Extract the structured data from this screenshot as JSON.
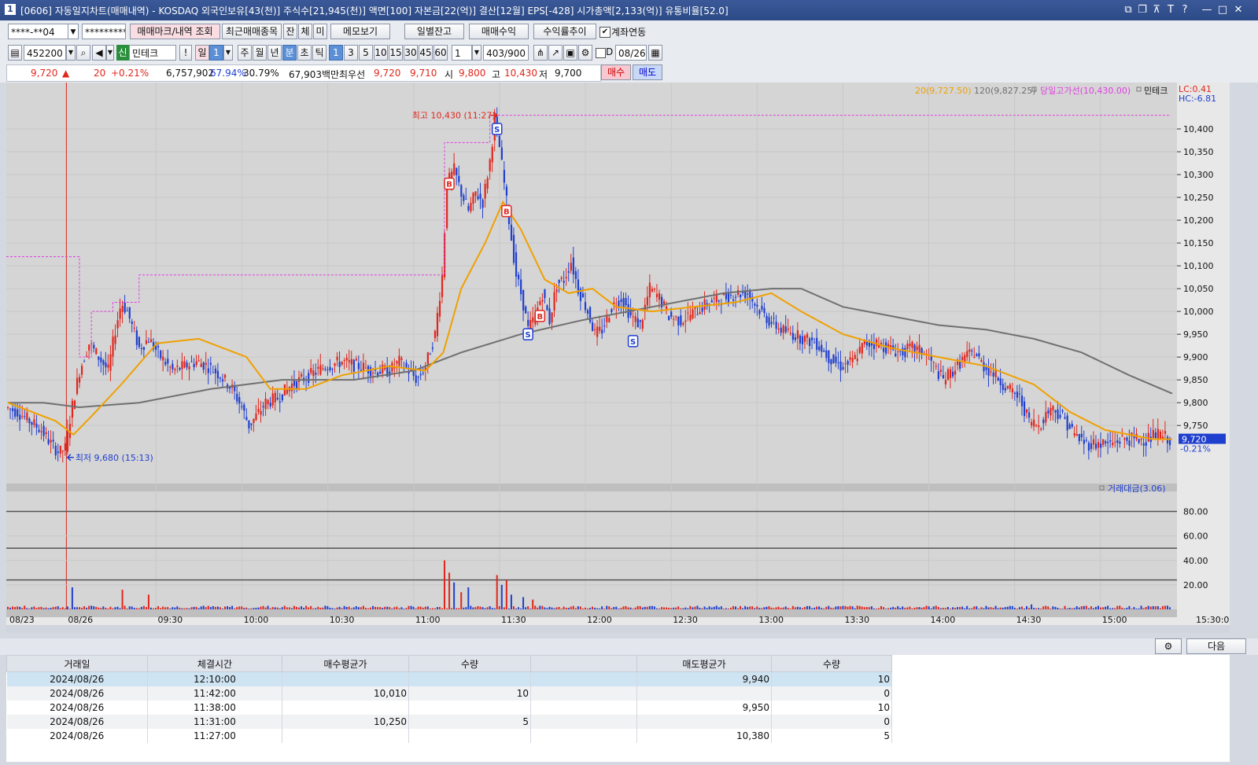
{
  "window": {
    "title": "[0606] 자동일지차트(매매내역) - KOSDAQ 외국인보유[43(천)] 주식수[21,945(천)] 액면[100] 자본금[22(억)] 결산[12월] EPS[-428] 시가총액[2,133(억)] 유통비율[52.0]",
    "app_num": "1"
  },
  "toolbar1": {
    "account": "****-**04",
    "password": "*********",
    "btn_markers": "매매마크/내역 조회",
    "btn_recent": "최근매매종목",
    "btn_jan": "잔",
    "btn_che": "체",
    "btn_mi": "미",
    "btn_memo": "메모보기",
    "btn_daily_bal": "일별잔고",
    "btn_profit": "매매수익",
    "btn_rate": "수익률추이",
    "chk_account_link": "계좌연동"
  },
  "toolbar2": {
    "code": "452200",
    "credit_badge": "신",
    "name": "민테크",
    "btn_excl": "!",
    "btn_day": "일",
    "day_val": "1",
    "periods": [
      "주",
      "월",
      "년",
      "분",
      "초",
      "틱"
    ],
    "intervals": [
      "1",
      "3",
      "5",
      "10",
      "15",
      "30",
      "45",
      "60"
    ],
    "count_val": "1",
    "range_text": "403/900",
    "d_label": "D",
    "date": "08/26"
  },
  "quote": {
    "price": "9,720",
    "arrow": "▲",
    "change": "20",
    "change_pct": "+0.21%",
    "volume": "6,757,902",
    "pct1": "67.94%",
    "pct2": "30.79%",
    "amount": "67,903백만",
    "best_label": "최우선",
    "ask": "9,720",
    "bid": "9,710",
    "open_label": "시",
    "open": "9,800",
    "high_label": "고",
    "high": "10,430",
    "low_label": "저",
    "low": "9,700",
    "btn_buy": "매수",
    "btn_sell": "매도"
  },
  "chart_data": {
    "type": "candlestick",
    "title": "",
    "legend": {
      "ma20": "20(9,727.50)",
      "ma120": "120(9,827.25)",
      "day_high_line": "당일고가선(10,430.00)",
      "stock": "민테크",
      "lc": "LC:0.41",
      "hc": "HC:-6.81"
    },
    "colors": {
      "up": "#e0261c",
      "down": "#1f3fcf",
      "ma20": "#f0a000",
      "ma120": "#707070",
      "day_high": "#e040e0",
      "grid": "#c8c8c8",
      "bg": "#d5d5d5"
    },
    "y_ticks": [
      "10,400",
      "10,350",
      "10,300",
      "10,250",
      "10,200",
      "10,150",
      "10,100",
      "10,050",
      "10,000",
      "9,950",
      "9,900",
      "9,850",
      "9,800",
      "9,750"
    ],
    "y_range": [
      9640,
      10450
    ],
    "current_price": "9,720",
    "current_pct": "-0.21%",
    "x_ticks": [
      "08/23",
      "08/26",
      "09:30",
      "10:00",
      "10:30",
      "11:00",
      "11:30",
      "12:00",
      "12:30",
      "13:00",
      "13:30",
      "14:00",
      "14:30",
      "15:00",
      "15:30:00"
    ],
    "annotations": {
      "high": "최고 10,430 (11:27)",
      "low": "최저 9,680 (15:13)"
    },
    "price_path": [
      [
        0,
        9790
      ],
      [
        10,
        9780
      ],
      [
        20,
        9760
      ],
      [
        30,
        9740
      ],
      [
        38,
        9710
      ],
      [
        45,
        9690
      ],
      [
        50,
        9700
      ],
      [
        55,
        9780
      ],
      [
        62,
        9870
      ],
      [
        70,
        9930
      ],
      [
        78,
        9900
      ],
      [
        86,
        9870
      ],
      [
        92,
        9960
      ],
      [
        97,
        10020
      ],
      [
        102,
        10000
      ],
      [
        107,
        9960
      ],
      [
        112,
        9920
      ],
      [
        120,
        9940
      ],
      [
        130,
        9900
      ],
      [
        140,
        9870
      ],
      [
        150,
        9880
      ],
      [
        160,
        9890
      ],
      [
        170,
        9880
      ],
      [
        180,
        9860
      ],
      [
        190,
        9830
      ],
      [
        198,
        9790
      ],
      [
        204,
        9750
      ],
      [
        210,
        9770
      ],
      [
        218,
        9800
      ],
      [
        228,
        9810
      ],
      [
        240,
        9840
      ],
      [
        255,
        9860
      ],
      [
        268,
        9880
      ],
      [
        282,
        9890
      ],
      [
        296,
        9880
      ],
      [
        310,
        9870
      ],
      [
        322,
        9870
      ],
      [
        330,
        9890
      ],
      [
        338,
        9870
      ],
      [
        345,
        9850
      ],
      [
        352,
        9880
      ],
      [
        360,
        9950
      ],
      [
        366,
        10080
      ],
      [
        370,
        10280
      ],
      [
        376,
        10310
      ],
      [
        382,
        10260
      ],
      [
        388,
        10220
      ],
      [
        394,
        10260
      ],
      [
        400,
        10240
      ],
      [
        406,
        10330
      ],
      [
        410,
        10420
      ],
      [
        414,
        10360
      ],
      [
        418,
        10280
      ],
      [
        423,
        10180
      ],
      [
        428,
        10080
      ],
      [
        433,
        10030
      ],
      [
        438,
        9960
      ],
      [
        444,
        9990
      ],
      [
        450,
        10040
      ],
      [
        456,
        9980
      ],
      [
        462,
        10060
      ],
      [
        468,
        10070
      ],
      [
        474,
        10110
      ],
      [
        480,
        10050
      ],
      [
        488,
        10000
      ],
      [
        494,
        9950
      ],
      [
        500,
        9960
      ],
      [
        508,
        10010
      ],
      [
        516,
        10030
      ],
      [
        524,
        9990
      ],
      [
        532,
        9970
      ],
      [
        540,
        10050
      ],
      [
        548,
        10030
      ],
      [
        556,
        9990
      ],
      [
        566,
        9980
      ],
      [
        578,
        10000
      ],
      [
        590,
        10020
      ],
      [
        602,
        10030
      ],
      [
        614,
        10040
      ],
      [
        622,
        10040
      ],
      [
        630,
        10010
      ],
      [
        640,
        9980
      ],
      [
        650,
        9960
      ],
      [
        660,
        9950
      ],
      [
        670,
        9940
      ],
      [
        680,
        9930
      ],
      [
        690,
        9900
      ],
      [
        700,
        9880
      ],
      [
        710,
        9890
      ],
      [
        720,
        9930
      ],
      [
        730,
        9930
      ],
      [
        740,
        9920
      ],
      [
        750,
        9910
      ],
      [
        760,
        9920
      ],
      [
        770,
        9910
      ],
      [
        778,
        9880
      ],
      [
        786,
        9850
      ],
      [
        794,
        9870
      ],
      [
        804,
        9900
      ],
      [
        812,
        9910
      ],
      [
        820,
        9880
      ],
      [
        830,
        9860
      ],
      [
        840,
        9830
      ],
      [
        850,
        9810
      ],
      [
        858,
        9760
      ],
      [
        866,
        9750
      ],
      [
        876,
        9790
      ],
      [
        886,
        9770
      ],
      [
        896,
        9730
      ],
      [
        906,
        9710
      ],
      [
        916,
        9710
      ],
      [
        926,
        9710
      ],
      [
        936,
        9720
      ],
      [
        946,
        9720
      ],
      [
        956,
        9720
      ],
      [
        966,
        9730
      ],
      [
        976,
        9720
      ]
    ],
    "ma20_path": [
      [
        0,
        9800
      ],
      [
        40,
        9760
      ],
      [
        55,
        9730
      ],
      [
        70,
        9770
      ],
      [
        95,
        9840
      ],
      [
        125,
        9930
      ],
      [
        160,
        9940
      ],
      [
        200,
        9900
      ],
      [
        220,
        9830
      ],
      [
        250,
        9830
      ],
      [
        280,
        9860
      ],
      [
        320,
        9880
      ],
      [
        350,
        9870
      ],
      [
        365,
        9910
      ],
      [
        380,
        10050
      ],
      [
        400,
        10150
      ],
      [
        415,
        10240
      ],
      [
        430,
        10180
      ],
      [
        450,
        10070
      ],
      [
        470,
        10040
      ],
      [
        490,
        10050
      ],
      [
        510,
        10010
      ],
      [
        540,
        10000
      ],
      [
        575,
        10010
      ],
      [
        610,
        10020
      ],
      [
        640,
        10040
      ],
      [
        665,
        10000
      ],
      [
        700,
        9950
      ],
      [
        740,
        9920
      ],
      [
        780,
        9900
      ],
      [
        820,
        9880
      ],
      [
        860,
        9840
      ],
      [
        890,
        9780
      ],
      [
        920,
        9740
      ],
      [
        960,
        9720
      ],
      [
        976,
        9720
      ]
    ],
    "ma120_path": [
      [
        0,
        9800
      ],
      [
        30,
        9800
      ],
      [
        60,
        9790
      ],
      [
        110,
        9800
      ],
      [
        170,
        9830
      ],
      [
        230,
        9850
      ],
      [
        290,
        9850
      ],
      [
        340,
        9870
      ],
      [
        380,
        9910
      ],
      [
        430,
        9950
      ],
      [
        480,
        9980
      ],
      [
        540,
        10010
      ],
      [
        600,
        10040
      ],
      [
        640,
        10050
      ],
      [
        665,
        10050
      ],
      [
        700,
        10010
      ],
      [
        740,
        9990
      ],
      [
        780,
        9970
      ],
      [
        820,
        9960
      ],
      [
        860,
        9940
      ],
      [
        900,
        9910
      ],
      [
        940,
        9860
      ],
      [
        976,
        9820
      ]
    ],
    "day_high_line": 10420,
    "trade_marks": [
      {
        "type": "B",
        "label": "B",
        "i": 370,
        "price": 10280
      },
      {
        "type": "S",
        "label": "S",
        "i": 410,
        "price": 10400
      },
      {
        "type": "B",
        "label": "B",
        "i": 418,
        "price": 10220
      },
      {
        "type": "S",
        "label": "S",
        "i": 436,
        "price": 9950
      },
      {
        "type": "B",
        "label": "B",
        "i": 446,
        "price": 9990
      },
      {
        "type": "S",
        "label": "S",
        "i": 524,
        "price": 9935
      }
    ],
    "volume_panel": {
      "legend": "거래대금(3.06)",
      "y_ticks": [
        "80.00",
        "60.00",
        "40.00",
        "20.00"
      ],
      "y_range": [
        0,
        90
      ],
      "spikes": [
        {
          "i": 55,
          "v": 18,
          "up": false
        },
        {
          "i": 96,
          "v": 16,
          "up": true
        },
        {
          "i": 118,
          "v": 12,
          "up": true
        },
        {
          "i": 366,
          "v": 40,
          "up": true
        },
        {
          "i": 370,
          "v": 30,
          "up": true
        },
        {
          "i": 374,
          "v": 22,
          "up": false
        },
        {
          "i": 380,
          "v": 14,
          "up": true
        },
        {
          "i": 386,
          "v": 18,
          "up": false
        },
        {
          "i": 410,
          "v": 28,
          "up": true
        },
        {
          "i": 414,
          "v": 20,
          "up": false
        },
        {
          "i": 418,
          "v": 24,
          "up": true
        },
        {
          "i": 423,
          "v": 12,
          "up": false
        },
        {
          "i": 432,
          "v": 10,
          "up": false
        },
        {
          "i": 440,
          "v": 8,
          "up": true
        },
        {
          "i": 858,
          "v": 4,
          "up": false
        },
        {
          "i": 976,
          "v": 3,
          "up": false
        }
      ]
    }
  },
  "trade_table": {
    "columns": [
      "거래일",
      "체결시간",
      "매수평균가",
      "수량",
      "",
      "매도평균가",
      "수량"
    ],
    "rows": [
      [
        "2024/08/26",
        "12:10:00",
        "",
        "",
        "",
        "9,940",
        "10"
      ],
      [
        "2024/08/26",
        "11:42:00",
        "10,010",
        "10",
        "",
        "",
        "0"
      ],
      [
        "2024/08/26",
        "11:38:00",
        "",
        "",
        "",
        "9,950",
        "10"
      ],
      [
        "2024/08/26",
        "11:31:00",
        "10,250",
        "5",
        "",
        "",
        "0"
      ],
      [
        "2024/08/26",
        "11:27:00",
        "",
        "",
        "",
        "10,380",
        "5"
      ]
    ],
    "btn_next": "다음"
  }
}
